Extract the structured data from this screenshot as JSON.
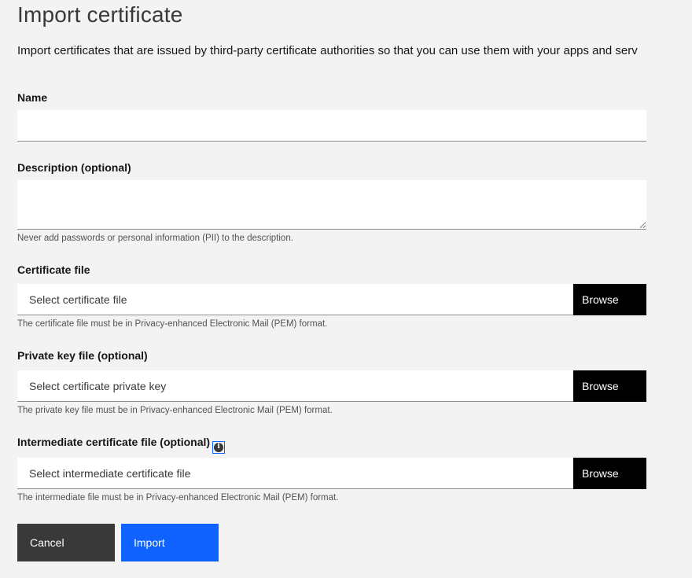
{
  "page": {
    "title": "Import certificate",
    "intro": "Import certificates that are issued by third-party certificate authorities so that you can use them with your apps and serv"
  },
  "form": {
    "name": {
      "label": "Name",
      "value": ""
    },
    "description": {
      "label": "Description (optional)",
      "value": "",
      "helper": "Never add passwords or personal information (PII) to the description."
    },
    "certificate_file": {
      "label": "Certificate file",
      "placeholder": "Select certificate file",
      "browse_label": "Browse",
      "helper": "The certificate file must be in Privacy-enhanced Electronic Mail (PEM) format."
    },
    "private_key_file": {
      "label": "Private key file (optional)",
      "placeholder": "Select certificate private key",
      "browse_label": "Browse",
      "helper": "The private key file must be in Privacy-enhanced Electronic Mail (PEM) format."
    },
    "intermediate_file": {
      "label": "Intermediate certificate file (optional)",
      "info_icon": "info-icon",
      "placeholder": "Select intermediate certificate file",
      "browse_label": "Browse",
      "helper": "The intermediate file must be in Privacy-enhanced Electronic Mail (PEM) format."
    }
  },
  "actions": {
    "cancel_label": "Cancel",
    "import_label": "Import"
  },
  "colors": {
    "background": "#f3f3f3",
    "primary": "#0f62fe",
    "secondary": "#393939",
    "browse": "#000000"
  }
}
